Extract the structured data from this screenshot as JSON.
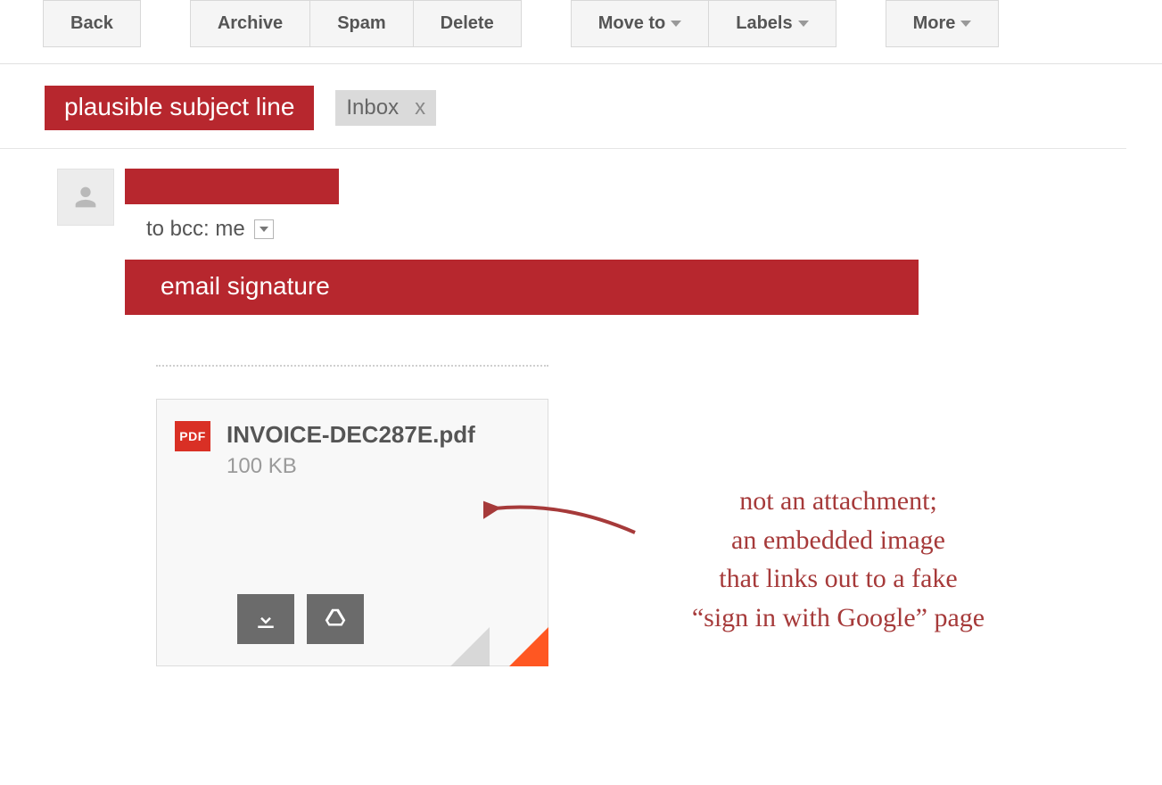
{
  "toolbar": {
    "back": "Back",
    "archive": "Archive",
    "spam": "Spam",
    "delete": "Delete",
    "move_to": "Move to",
    "labels": "Labels",
    "more": "More"
  },
  "subject": {
    "redaction_label": "plausible subject line"
  },
  "label_chip": {
    "name": "Inbox",
    "close": "x"
  },
  "recipient_line": "to bcc: me",
  "signature_label": "email signature",
  "attachment": {
    "badge": "PDF",
    "filename": "INVOICE-DEC287E.pdf",
    "size": "100 KB"
  },
  "annotation": {
    "line1": "not an attachment;",
    "line2": "an embedded image",
    "line3": "that links out to a fake",
    "line4": "“sign in with Google” page"
  }
}
